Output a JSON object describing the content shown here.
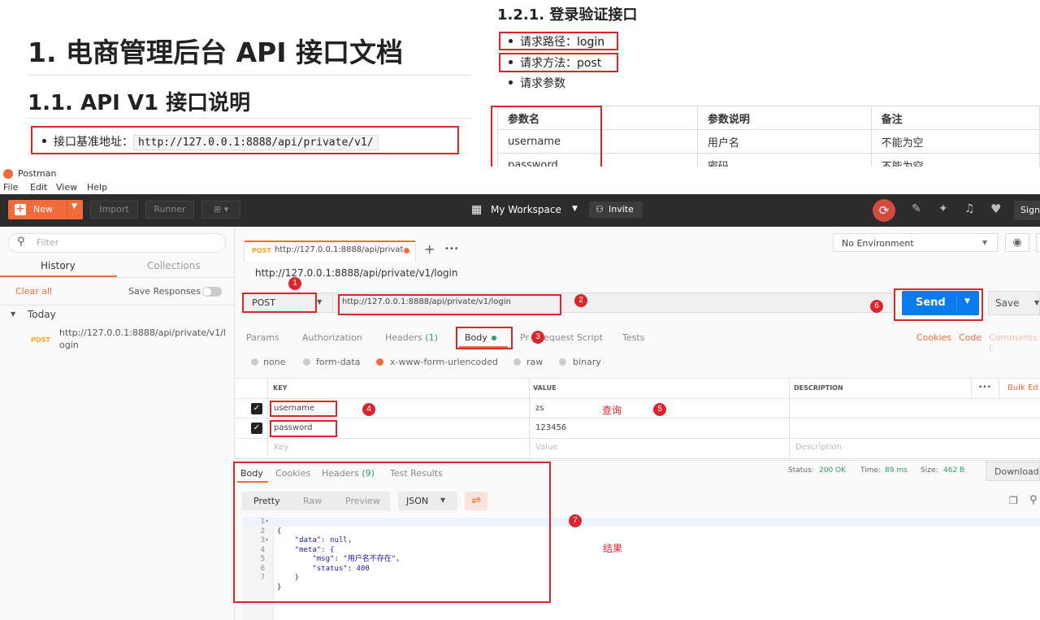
{
  "doc_left": {
    "h1": "1. 电商管理后台 API 接口文档",
    "h2": "1.1. API V1 接口说明",
    "base_label": "接口基准地址：",
    "base_url": "http://127.0.0.1:8888/api/private/v1/"
  },
  "doc_right": {
    "h3": "1.2.1. 登录验证接口",
    "path_label": "请求路径：",
    "path_value": "login",
    "method_label": "请求方法：",
    "method_value": "post",
    "params_label": "请求参数",
    "table": {
      "headers": [
        "参数名",
        "参数说明",
        "备注"
      ],
      "rows": [
        [
          "username",
          "用户名",
          "不能为空"
        ],
        [
          "password",
          "密码",
          "不能为空"
        ]
      ]
    }
  },
  "app": {
    "title": "Postman",
    "menu": [
      "File",
      "Edit",
      "View",
      "Help"
    ]
  },
  "header": {
    "new": "New",
    "import": "Import",
    "runner": "Runner",
    "workspace": "My Workspace",
    "invite": "Invite",
    "sign": "Sign"
  },
  "sidebar": {
    "filter_placeholder": "Filter",
    "tab_history": "History",
    "tab_collections": "Collections",
    "clear_all": "Clear all",
    "save_responses": "Save Responses",
    "today": "Today",
    "item_method": "POST",
    "item_url_1": "http://127.0.0.1:8888/api/private/v1/l",
    "item_url_2": "ogin"
  },
  "request": {
    "tab_method": "POST",
    "tab_url": "http://127.0.0.1:8888/api/privat",
    "plus": "+",
    "more": "•••",
    "environment": "No Environment",
    "title_url": "http://127.0.0.1:8888/api/private/v1/login",
    "method": "POST",
    "url": "http://127.0.0.1:8888/api/private/v1/login",
    "send": "Send",
    "save": "Save",
    "tabs": [
      "Params",
      "Authorization",
      "Headers",
      "Body",
      "Pre-request Script",
      "Tests"
    ],
    "headers_count": "(1)",
    "prerequest_left": "Pr",
    "prerequest_right": "equest Script",
    "cookies": "Cookies",
    "code": "Code",
    "comments": "Comments (",
    "body_types": [
      "none",
      "form-data",
      "x-www-form-urlencoded",
      "raw",
      "binary"
    ],
    "kv_headers": [
      "KEY",
      "VALUE",
      "DESCRIPTION"
    ],
    "kv_more": "•••",
    "bulk_edit": "Bulk Ed",
    "rows": [
      {
        "key": "username",
        "value": "zs"
      },
      {
        "key": "password",
        "value": "123456"
      }
    ],
    "placeholder_key": "Key",
    "placeholder_value": "Value",
    "placeholder_desc": "Description"
  },
  "response": {
    "tabs": [
      "Body",
      "Cookies",
      "Headers",
      "Test Results"
    ],
    "headers_count": "(9)",
    "status_label": "Status:",
    "status_value": "200 OK",
    "time_label": "Time:",
    "time_value": "89 ms",
    "size_label": "Size:",
    "size_value": "462 B",
    "download": "Download",
    "view_pretty": "Pretty",
    "view_raw": "Raw",
    "view_preview": "Preview",
    "format": "JSON",
    "code_lines": [
      "{",
      "    \"data\": null,",
      "    \"meta\": {",
      "        \"msg\": \"用户名不存在\",",
      "        \"status\": 400",
      "    }",
      "}"
    ],
    "line_numbers": [
      "1",
      "2",
      "3",
      "4",
      "5",
      "6",
      "7"
    ]
  },
  "annotations": {
    "n1": "1",
    "n2": "2",
    "n3": "3",
    "n4": "4",
    "n5": "5",
    "n6": "6",
    "n7": "7",
    "query": "查询",
    "result": "结果"
  },
  "colors": {
    "accent_orange": "#f26b3a",
    "send_blue": "#097bed",
    "annotation_red": "#d9262c",
    "header_dark": "#2c2c2c"
  }
}
